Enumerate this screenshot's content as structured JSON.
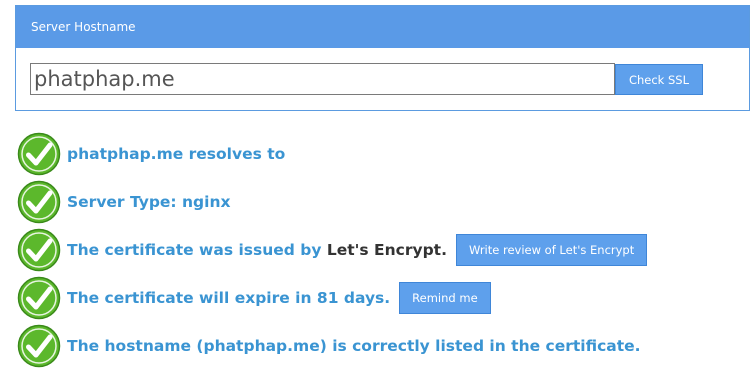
{
  "panel": {
    "title": "Server Hostname",
    "input_value": "phatphap.me",
    "check_button": "Check SSL"
  },
  "results": [
    {
      "icon": "check-icon",
      "text": "phatphap.me resolves to"
    },
    {
      "icon": "check-icon",
      "text": "Server Type: nginx"
    },
    {
      "icon": "check-icon",
      "text": "The certificate was issued by ",
      "highlight": "Let's Encrypt.",
      "button": "Write review of Let's Encrypt"
    },
    {
      "icon": "check-icon",
      "text": "The certificate will expire in 81 days.",
      "button": "Remind me"
    },
    {
      "icon": "check-icon",
      "text": "The hostname (phatphap.me) is correctly listed in the certificate."
    }
  ],
  "colors": {
    "accent": "#5a9ae7",
    "result_text": "#3a94d2",
    "check_green": "#5cb82c"
  }
}
